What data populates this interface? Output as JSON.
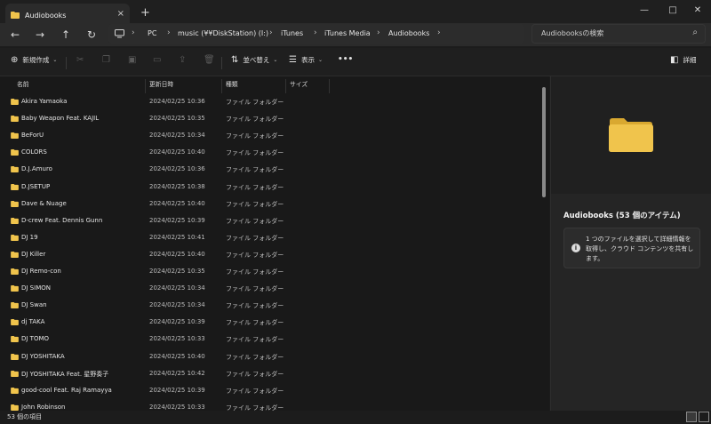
{
  "window": {
    "tab_title": "Audiobooks",
    "tab_close_icon": "×",
    "new_tab_icon": "+",
    "min_icon": "—",
    "max_icon": "□",
    "close_icon": "✕"
  },
  "nav": {
    "back_icon": "←",
    "forward_icon": "→",
    "up_icon": "↑",
    "refresh_icon": "↻"
  },
  "breadcrumb": {
    "pc_icon": "monitor-icon",
    "items": [
      "PC",
      "music (¥¥DiskStation) (I:)",
      "iTunes",
      "iTunes Media",
      "Audiobooks"
    ]
  },
  "search": {
    "placeholder": "Audiobooksの検索",
    "icon": "⌕"
  },
  "toolbar": {
    "new_label": "新規作成",
    "sort_label": "並べ替え",
    "view_label": "表示",
    "more_label": "•••",
    "details_label": "詳細"
  },
  "columns": {
    "name": "名前",
    "date": "更新日時",
    "type": "種類",
    "size": "サイズ"
  },
  "files": [
    {
      "name": "Akira Yamaoka",
      "date": "2024/02/25 10:36",
      "type": "ファイル フォルダー"
    },
    {
      "name": "Baby Weapon Feat. KAJIL",
      "date": "2024/02/25 10:35",
      "type": "ファイル フォルダー"
    },
    {
      "name": "BeForU",
      "date": "2024/02/25 10:34",
      "type": "ファイル フォルダー"
    },
    {
      "name": "COLORS",
      "date": "2024/02/25 10:40",
      "type": "ファイル フォルダー"
    },
    {
      "name": "D.J.Amuro",
      "date": "2024/02/25 10:36",
      "type": "ファイル フォルダー"
    },
    {
      "name": "D.JSETUP",
      "date": "2024/02/25 10:38",
      "type": "ファイル フォルダー"
    },
    {
      "name": "Dave & Nuage",
      "date": "2024/02/25 10:40",
      "type": "ファイル フォルダー"
    },
    {
      "name": "D-crew Feat. Dennis Gunn",
      "date": "2024/02/25 10:39",
      "type": "ファイル フォルダー"
    },
    {
      "name": "DJ 19",
      "date": "2024/02/25 10:41",
      "type": "ファイル フォルダー"
    },
    {
      "name": "DJ Killer",
      "date": "2024/02/25 10:40",
      "type": "ファイル フォルダー"
    },
    {
      "name": "DJ Remo-con",
      "date": "2024/02/25 10:35",
      "type": "ファイル フォルダー"
    },
    {
      "name": "DJ SIMON",
      "date": "2024/02/25 10:34",
      "type": "ファイル フォルダー"
    },
    {
      "name": "DJ Swan",
      "date": "2024/02/25 10:34",
      "type": "ファイル フォルダー"
    },
    {
      "name": "dj TAKA",
      "date": "2024/02/25 10:39",
      "type": "ファイル フォルダー"
    },
    {
      "name": "DJ TOMO",
      "date": "2024/02/25 10:33",
      "type": "ファイル フォルダー"
    },
    {
      "name": "DJ YOSHITAKA",
      "date": "2024/02/25 10:40",
      "type": "ファイル フォルダー"
    },
    {
      "name": "DJ YOSHITAKA Feat. 星野奏子",
      "date": "2024/02/25 10:42",
      "type": "ファイル フォルダー"
    },
    {
      "name": "good-cool Feat. Raj Ramayya",
      "date": "2024/02/25 10:39",
      "type": "ファイル フォルダー"
    },
    {
      "name": "John Robinson",
      "date": "2024/02/25 10:33",
      "type": "ファイル フォルダー"
    }
  ],
  "details_pane": {
    "title": "Audiobooks (53 個のアイテム)",
    "info_icon": "i",
    "info_text": "1 つのファイルを選択して詳細情報を取得し、クラウド コンテンツを共有します。"
  },
  "status": {
    "count": "53 個の項目"
  },
  "colors": {
    "folder": "#f0c44c",
    "folder_dark": "#d9a830",
    "background": "#1c1c1c"
  }
}
